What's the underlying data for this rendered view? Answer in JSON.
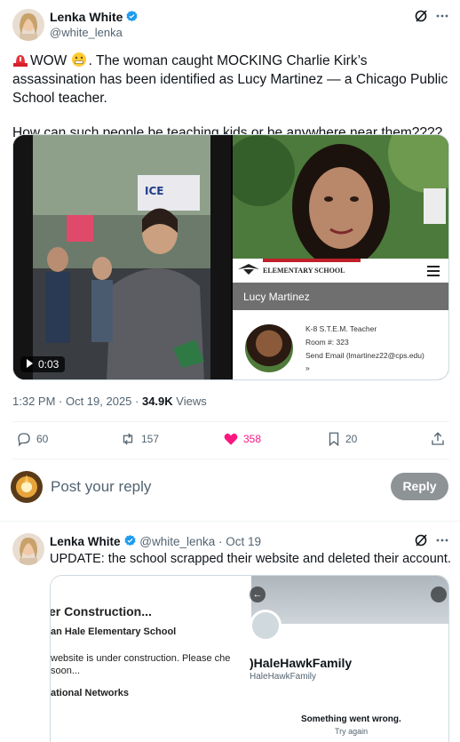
{
  "main_tweet": {
    "author_name": "Lenka White",
    "author_handle": "@white_lenka",
    "text_line1_prefix": "WOW",
    "text_line1_rest": ". The woman caught MOCKING Charlie Kirk’s assassination has been identified as Lucy Martinez — a Chicago Public School teacher.",
    "text_line2": "How can such people be teaching kids or be anywhere near them????",
    "video_time": "0:03",
    "video_sign": "ICE",
    "school_label": "ELEMENTARY SCHOOL",
    "teacher_name": "Lucy Martinez",
    "teacher_role": "K-8 S.T.E.M. Teacher",
    "teacher_room": "Room #: 323",
    "teacher_email": "Send Email (lmartinez22@cps.edu)",
    "teacher_more": "»",
    "timestamp": "1:32 PM · Oct 19, 2025 · ",
    "views_count": "34.9K",
    "views_label": " Views",
    "replies": "60",
    "reposts": "157",
    "likes": "358",
    "bookmarks": "20"
  },
  "reply_box": {
    "placeholder": "Post your reply",
    "button": "Reply"
  },
  "second_tweet": {
    "author_name": "Lenka White",
    "author_handle": "@white_lenka",
    "date": " · Oct 19",
    "text": "UPDATE: the school scrapped their website and deleted their account.",
    "construction_title": "er Construction...",
    "construction_school": "an Hale Elementary School",
    "construction_msg1": "website is under construction. Please che",
    "construction_msg2": "soon...",
    "construction_networks": "ational Networks",
    "profile_name": ")HaleHawkFamily",
    "profile_handle": "HaleHawkFamily",
    "profile_error": "Something went wrong.",
    "profile_retry": "Try again"
  },
  "colors": {
    "accent": "#1d9bf0",
    "like": "#f91880",
    "muted": "#536471",
    "reply_button": "#8e9396"
  }
}
